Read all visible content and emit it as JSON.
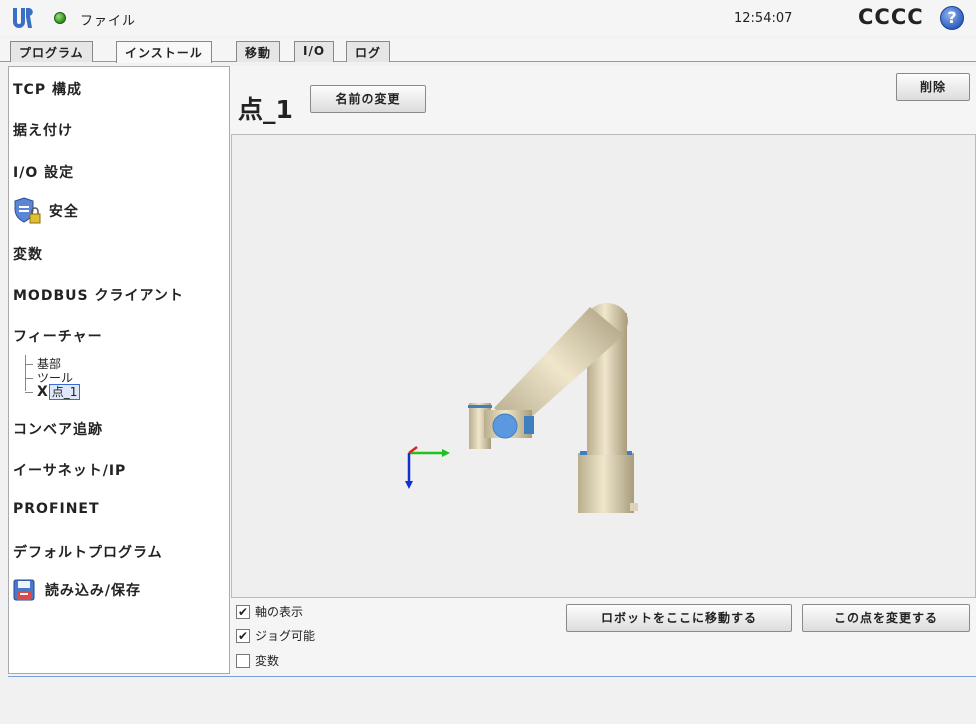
{
  "header": {
    "file_label": "ファイル",
    "clock": "12:54:07",
    "robot_name": "CCCC",
    "help_glyph": "?"
  },
  "tabs": [
    {
      "label": "プログラム",
      "active": false
    },
    {
      "label": "インストール",
      "active": true
    },
    {
      "label": "移動",
      "active": false
    },
    {
      "label": "I/O",
      "active": false
    },
    {
      "label": "ログ",
      "active": false
    }
  ],
  "sidebar": {
    "items": [
      {
        "label": "TCP 構成"
      },
      {
        "label": "据え付け"
      },
      {
        "label": "I/O 設定"
      },
      {
        "label": "安全",
        "icon": "shield-lock-icon"
      },
      {
        "label": "変数"
      },
      {
        "label": "MODBUS クライアント"
      },
      {
        "label": "フィーチャー"
      },
      {
        "label": "コンベア追跡"
      },
      {
        "label": "イーサネット/IP"
      },
      {
        "label": "PROFINET"
      },
      {
        "label": "デフォルトプログラム"
      },
      {
        "label": "読み込み/保存",
        "icon": "save-disk-icon"
      }
    ],
    "feature_tree": [
      {
        "label": "基部"
      },
      {
        "label": "ツール"
      },
      {
        "label": "点_1",
        "selected": true,
        "marker": "X"
      }
    ]
  },
  "main": {
    "point_title": "点_1",
    "rename_button": "名前の変更",
    "delete_button": "削除",
    "checkboxes": [
      {
        "label": "軸の表示",
        "checked": true
      },
      {
        "label": "ジョグ可能",
        "checked": true
      },
      {
        "label": "変数",
        "checked": false
      }
    ],
    "move_robot_button": "ロボットをここに移動する",
    "change_point_button": "この点を変更する"
  },
  "colors": {
    "robot_body": "#d8cdb0",
    "robot_joint_band": "#3f7fc0",
    "selection_blue": "#3a6bd0",
    "axis_x": "#e02020",
    "axis_y": "#20c020",
    "axis_z": "#1030d0"
  }
}
